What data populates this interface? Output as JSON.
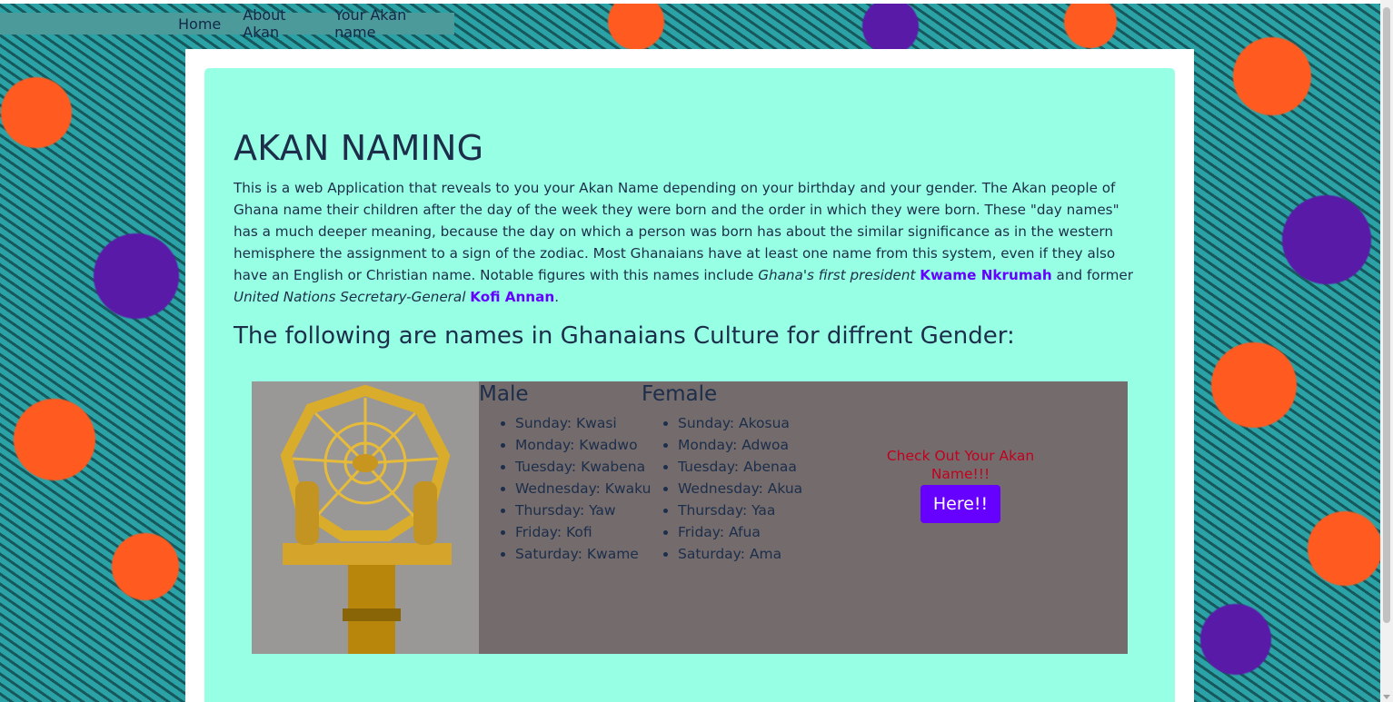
{
  "nav": {
    "items": [
      "Home",
      "About Akan",
      "Your Akan name"
    ]
  },
  "main": {
    "title": "AKAN NAMING",
    "intro": {
      "p1": "This is a web Application that reveals to you your Akan Name depending on your birthday and your gender. The Akan people of Ghana name their children after the day of the week they were born and the order in which they were born. These \"day names\" has a much deeper meaning, because the day on which a person was born has about the similar significance as in the western hemisphere the assignment to a sign of the zodiac. Most Ghanaians have at least one name from this system, even if they also have an English or Christian name. Notable figures with this names include ",
      "em1": "Ghana's first president",
      "link1": "Kwame Nkrumah",
      "p2": " and former ",
      "em2": "United Nations Secretary-General",
      "link2": "Kofi Annan",
      "p3": "."
    },
    "subtitle": "The following are names in Ghanaians Culture for diffrent Gender:",
    "male": {
      "heading": "Male",
      "items": [
        "Sunday: Kwasi",
        "Monday: Kwadwo",
        "Tuesday: Kwabena",
        "Wednesday: Kwaku",
        "Thursday: Yaw",
        "Friday: Kofi",
        "Saturday: Kwame"
      ]
    },
    "female": {
      "heading": "Female",
      "items": [
        "Sunday: Akosua",
        "Monday: Adwoa",
        "Tuesday: Abenaa",
        "Wednesday: Akua",
        "Thursday: Yaa",
        "Friday: Afua",
        "Saturday: Ama"
      ]
    },
    "cta": {
      "text": "Check Out Your Akan Name!!!",
      "button": "Here!!"
    }
  },
  "colors": {
    "accent": "#6600ff",
    "jumbotron": "#97ffe4",
    "panel": "#736b6c",
    "cta_text": "#c4001e",
    "text": "#1c2e4a"
  },
  "icons": [
    "golden-spider-web-staff-image"
  ]
}
